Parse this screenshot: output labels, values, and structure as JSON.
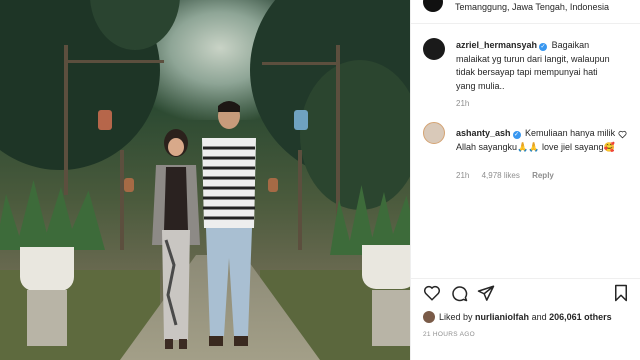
{
  "post": {
    "location": "Temanggung, Jawa Tengah, Indonesia",
    "time_ago": "21 HOURS AGO"
  },
  "caption": {
    "username": "azriel_hermansyah",
    "text": "Bagaikan malaikat yg turun dari langit, walaupun tidak bersayap tapi mempunyai hati yang mulia..",
    "time": "21h"
  },
  "comments": [
    {
      "username": "ashanty_ash",
      "text": "Kemuliaan hanya milik Allah sayangku🙏🙏 love jiel sayang🥰",
      "time": "21h",
      "likes": "4,978 likes",
      "reply_label": "Reply"
    }
  ],
  "likes": {
    "prefix": "Liked by",
    "user": "nurlianiolfah",
    "conjunction": "and",
    "count": "206,061 others"
  },
  "icons": {
    "like": "heart-icon",
    "comment": "comment-icon",
    "share": "share-icon",
    "save": "bookmark-icon",
    "verified": "verified-badge-icon",
    "comment_like": "heart-icon"
  },
  "colors": {
    "verified": "#3897f0",
    "meta_text": "#8e8e8e"
  }
}
